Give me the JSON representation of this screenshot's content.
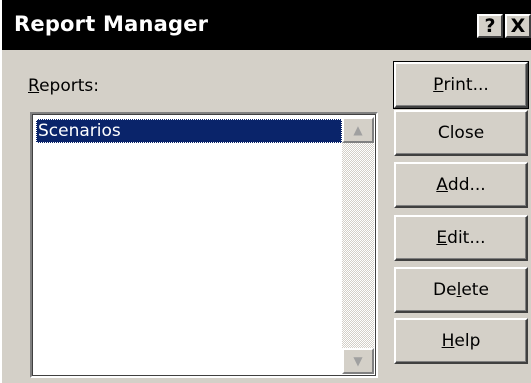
{
  "window": {
    "title": "Report Manager",
    "help_button": "?",
    "close_button": "X"
  },
  "reports": {
    "label_mnemonic": "R",
    "label_rest": "eports:",
    "items": [
      "Scenarios"
    ],
    "selected": "Scenarios"
  },
  "buttons": {
    "print": {
      "mnemonic": "P",
      "rest": "rint..."
    },
    "close": {
      "label": "Close"
    },
    "add": {
      "mnemonic": "A",
      "rest": "dd..."
    },
    "edit": {
      "mnemonic": "E",
      "rest": "dit..."
    },
    "delete": {
      "pre": "De",
      "mnemonic": "l",
      "rest": "ete"
    },
    "help": {
      "mnemonic": "H",
      "rest": "elp"
    }
  },
  "icons": {
    "scroll_up": "scroll-up-arrow",
    "scroll_down": "scroll-down-arrow"
  },
  "colors": {
    "titlebar": "#000000",
    "face": "#d4d0c8",
    "selection": "#0a246a"
  }
}
